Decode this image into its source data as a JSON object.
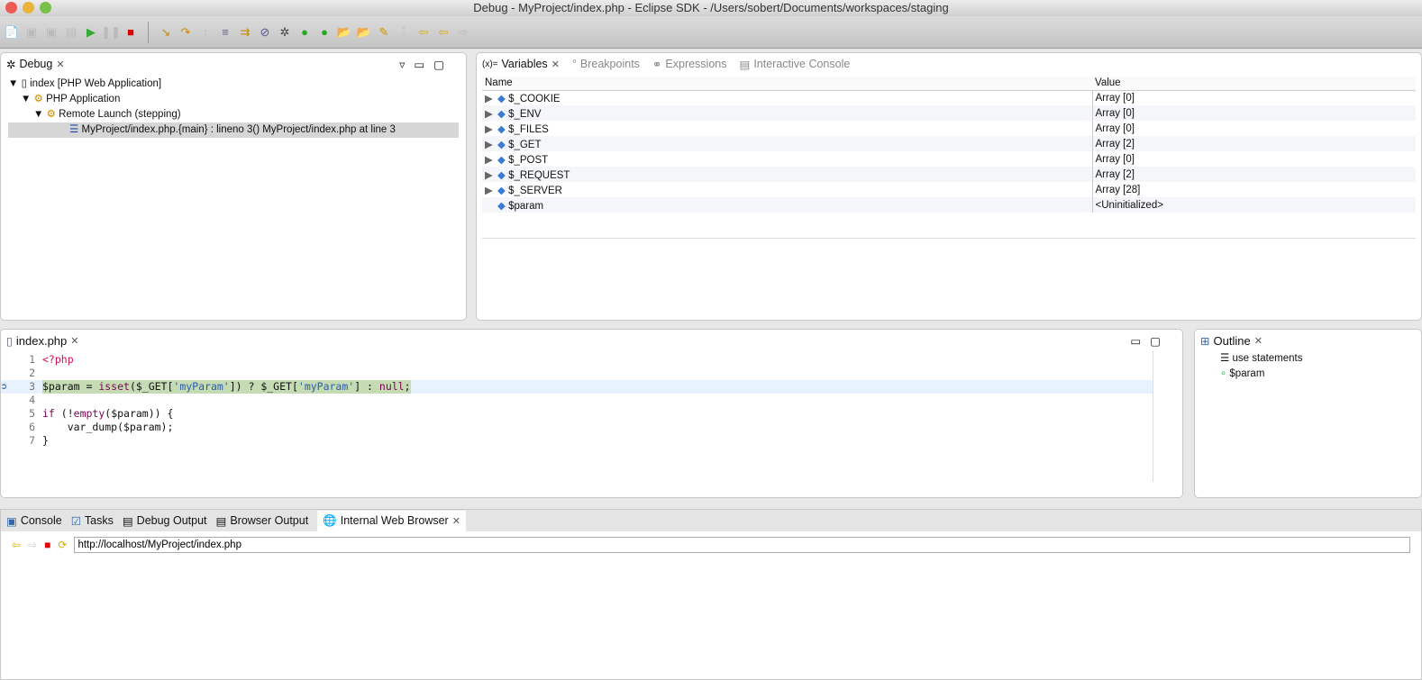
{
  "window": {
    "title": "Debug - MyProject/index.php - Eclipse SDK - /Users/sobert/Documents/workspaces/staging"
  },
  "debug": {
    "tab": "Debug",
    "tree": [
      "index [PHP Web Application]",
      "PHP Application",
      "Remote Launch (stepping)",
      "MyProject/index.php.{main} : lineno 3() MyProject/index.php at line 3"
    ]
  },
  "vars": {
    "tabs": [
      "Variables",
      "Breakpoints",
      "Expressions",
      "Interactive Console"
    ],
    "col_name": "Name",
    "col_value": "Value",
    "rows": [
      {
        "name": "$_COOKIE",
        "value": "Array [0]",
        "exp": true
      },
      {
        "name": "$_ENV",
        "value": "Array [0]",
        "exp": true
      },
      {
        "name": "$_FILES",
        "value": "Array [0]",
        "exp": true
      },
      {
        "name": "$_GET",
        "value": "Array [2]",
        "exp": true
      },
      {
        "name": "$_POST",
        "value": "Array [0]",
        "exp": true
      },
      {
        "name": "$_REQUEST",
        "value": "Array [2]",
        "exp": true
      },
      {
        "name": "$_SERVER",
        "value": "Array [28]",
        "exp": true
      },
      {
        "name": "$param",
        "value": "<Uninitialized>",
        "exp": false
      }
    ]
  },
  "editor": {
    "tab": "index.php",
    "lines": [
      [
        [
          "php",
          "<?php"
        ]
      ],
      [],
      [
        [
          "",
          "$param = "
        ],
        [
          "kw",
          "isset"
        ],
        [
          "",
          "($_GET["
        ],
        [
          "str",
          "'myParam'"
        ],
        [
          "",
          "]) ? $_GET["
        ],
        [
          "str",
          "'myParam'"
        ],
        [
          "",
          "] : "
        ],
        [
          "kw",
          "null"
        ],
        [
          "",
          ";"
        ]
      ],
      [],
      [
        [
          "kw",
          "if"
        ],
        [
          "",
          " (!"
        ],
        [
          "kw",
          "empty"
        ],
        [
          "",
          "($param)) {"
        ]
      ],
      [
        [
          "",
          "    var_dump($param);"
        ]
      ],
      [
        [
          "",
          "}"
        ]
      ]
    ]
  },
  "outline": {
    "tab": "Outline",
    "items": [
      "use statements",
      "$param"
    ]
  },
  "bottom": {
    "tabs": [
      "Console",
      "Tasks",
      "Debug Output",
      "Browser Output",
      "Internal Web Browser"
    ],
    "url": "http://localhost/MyProject/index.php"
  }
}
